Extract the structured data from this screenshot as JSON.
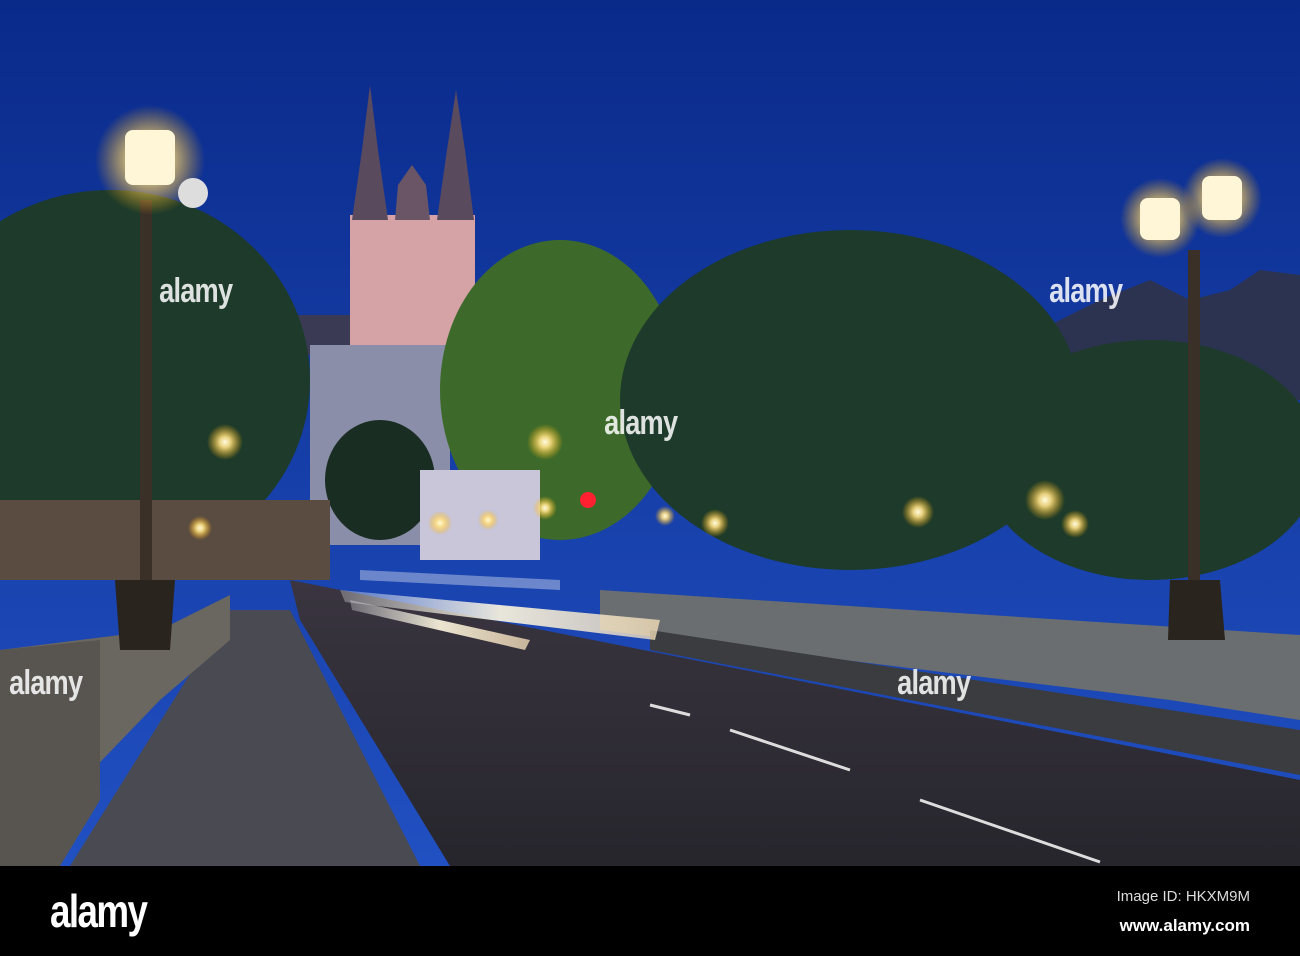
{
  "photo": {
    "watermark_text": "alamy",
    "colors": {
      "sky_top": "#0a2a8a",
      "sky_bottom": "#1f4fc0",
      "lamp": "#fff3c0",
      "cathedral": "#d8a9a8",
      "road": "#2b2a33"
    }
  },
  "footer": {
    "logo": "alamy",
    "image_id": "Image ID: HKXM9M",
    "website": "www.alamy.com"
  }
}
